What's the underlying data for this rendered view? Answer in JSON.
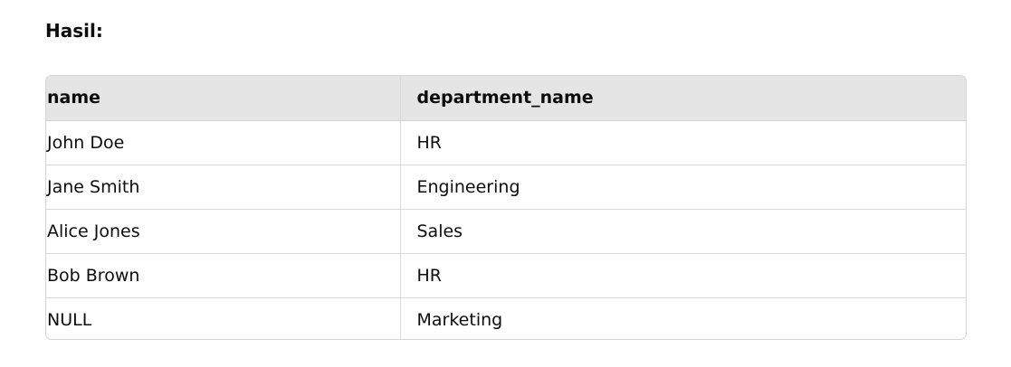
{
  "heading": "Hasil:",
  "table": {
    "headers": [
      "name",
      "department_name"
    ],
    "rows": [
      [
        "John Doe",
        "HR"
      ],
      [
        "Jane Smith",
        "Engineering"
      ],
      [
        "Alice Jones",
        "Sales"
      ],
      [
        "Bob Brown",
        "HR"
      ],
      [
        "NULL",
        "Marketing"
      ]
    ]
  }
}
